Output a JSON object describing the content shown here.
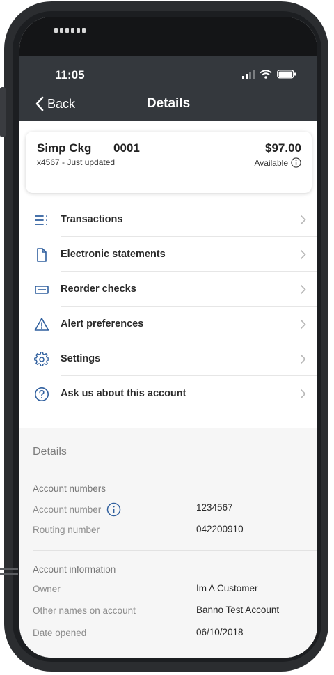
{
  "status_bar": {
    "time": "11:05"
  },
  "nav": {
    "back_label": "Back",
    "title": "Details"
  },
  "account_card": {
    "name": "Simp Ckg",
    "number": "0001",
    "subtitle": "x4567 - Just updated",
    "balance": "$97.00",
    "available_label": "Available"
  },
  "menu": [
    {
      "label": "Transactions",
      "icon": "list-icon"
    },
    {
      "label": "Electronic statements",
      "icon": "document-icon"
    },
    {
      "label": "Reorder checks",
      "icon": "check-icon"
    },
    {
      "label": "Alert preferences",
      "icon": "alert-triangle-icon"
    },
    {
      "label": "Settings",
      "icon": "gear-icon"
    },
    {
      "label": "Ask us about this account",
      "icon": "question-circle-icon"
    }
  ],
  "details": {
    "title": "Details",
    "account_numbers": {
      "heading": "Account numbers",
      "rows": [
        {
          "label": "Account number",
          "value": "1234567"
        },
        {
          "label": "Routing number",
          "value": "042200910"
        }
      ]
    },
    "account_information": {
      "heading": "Account information",
      "rows": [
        {
          "label": "Owner",
          "value": "Im A Customer"
        },
        {
          "label": "Other names on account",
          "value": "Banno Test Account"
        },
        {
          "label": "Date opened",
          "value": "06/10/2018"
        }
      ]
    }
  },
  "colors": {
    "header_bg": "#34383d",
    "accent": "#2f5f9e",
    "device": "#2b2d30"
  }
}
